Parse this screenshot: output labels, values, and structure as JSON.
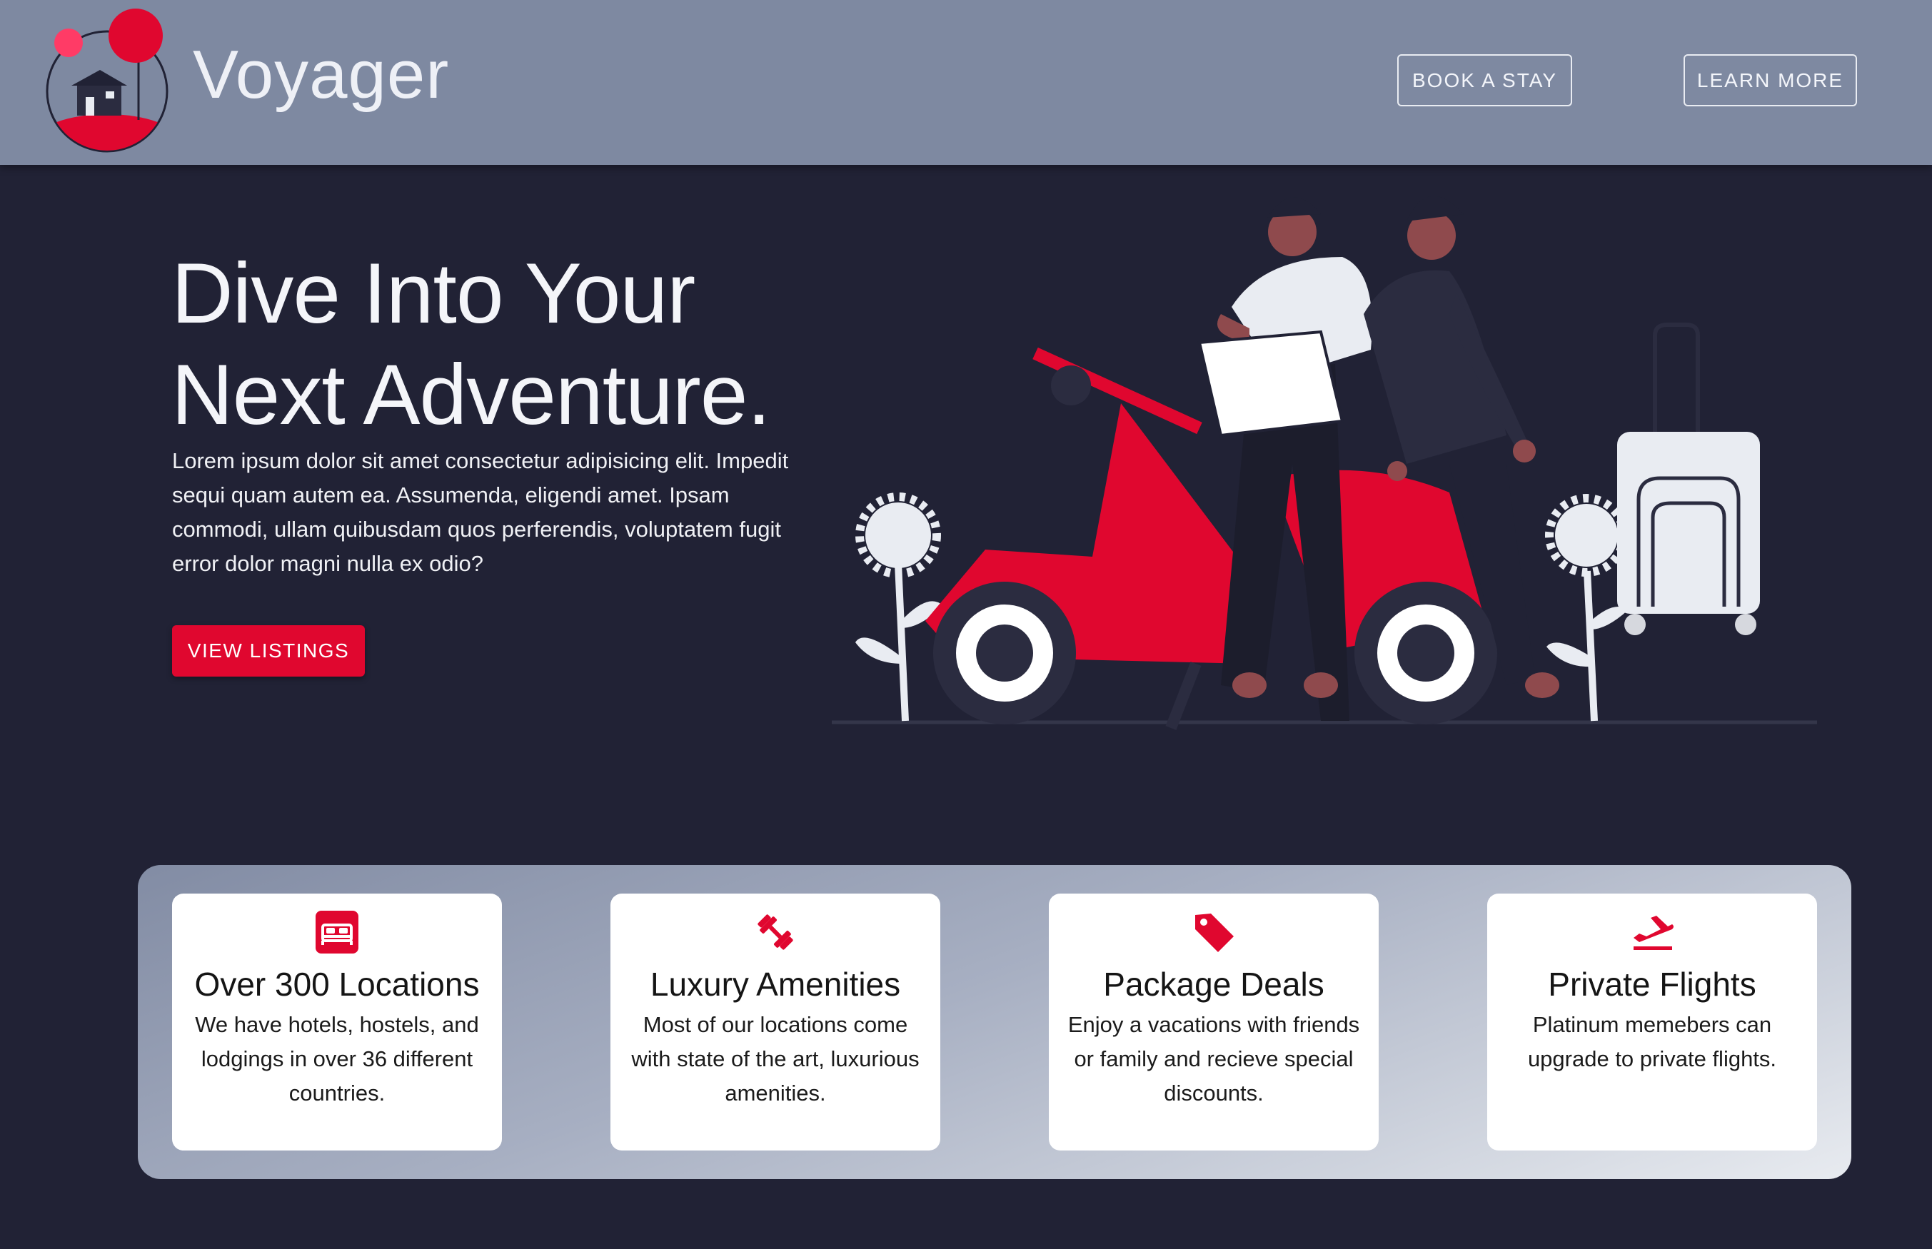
{
  "header": {
    "brand": "Voyager",
    "nav": [
      {
        "label": "BOOK A STAY"
      },
      {
        "label": "LEARN MORE"
      }
    ]
  },
  "hero": {
    "title_line1": "Dive Into Your",
    "title_line2": "Next Adventure.",
    "description": "Lorem ipsum dolor sit amet consectetur adipisicing elit. Impedit sequi quam autem ea. Assumenda, eligendi amet. Ipsam commodi, ullam quibusdam quos perferendis, voluptatem fugit error dolor magni nulla ex odio?",
    "cta_label": "VIEW LISTINGS"
  },
  "features": [
    {
      "icon": "bed-icon",
      "title": "Over 300 Locations",
      "text": "We have hotels, hostels, and lodgings in over 36 different countries."
    },
    {
      "icon": "dumbbell-icon",
      "title": "Luxury Amenities",
      "text": "Most of our locations come with state of the art, luxurious amenities."
    },
    {
      "icon": "price-tag-icon",
      "title": "Package Deals",
      "text": "Enjoy a vacations with friends or family and recieve special discounts."
    },
    {
      "icon": "flight-takeoff-icon",
      "title": "Private Flights",
      "text": "Platinum memebers can upgrade to private flights."
    }
  ],
  "colors": {
    "accent": "#e0072f",
    "header_bg": "#7e89a1",
    "page_bg": "#212235"
  }
}
